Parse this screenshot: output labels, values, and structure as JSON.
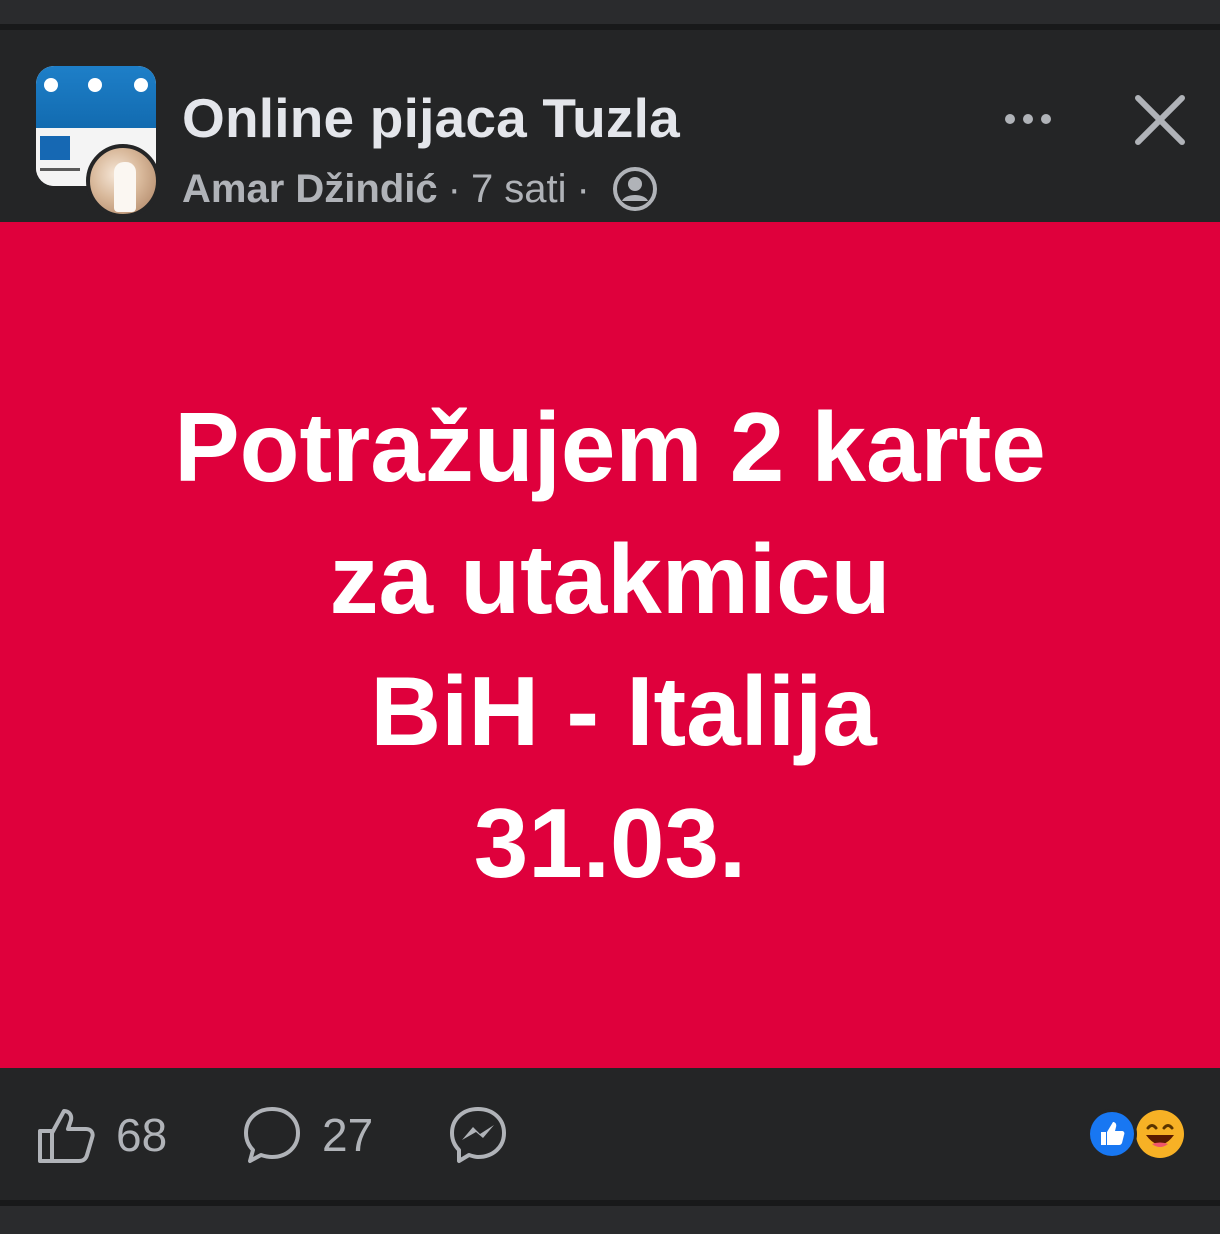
{
  "post": {
    "group_name": "Online pijaca Tuzla",
    "author": "Amar Džindić",
    "separator": "·",
    "time": "7 sati",
    "image_text_lines": [
      "Potražujem 2 karte",
      "za utakmicu",
      " BiH - Italija",
      "31.03."
    ],
    "image_background": "#df003c",
    "image_text_color": "#ffffff"
  },
  "footer": {
    "likes": "68",
    "comments": "27"
  },
  "icons": {
    "more": "more-options-icon",
    "close": "close-icon",
    "privacy": "members-only-icon",
    "like": "thumbs-up-icon",
    "comment": "comment-icon",
    "share": "messenger-icon",
    "reactions": [
      "like-reaction-icon",
      "haha-reaction-icon"
    ]
  },
  "colors": {
    "background": "#18191a",
    "surface": "#242526",
    "primary_text": "#e4e6eb",
    "secondary_text": "#b0b3b8",
    "like_blue": "#1877f2",
    "haha_yellow": "#f7b125"
  }
}
